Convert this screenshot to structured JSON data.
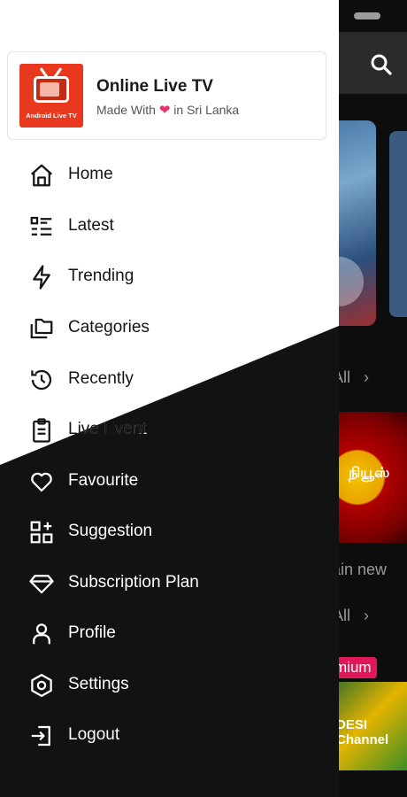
{
  "app": {
    "title": "Online Live TV",
    "subtitle_prefix": "Made With",
    "subtitle_suffix": "in Sri Lanka",
    "logo_text": "Android Live TV"
  },
  "menu": [
    {
      "label": "Home",
      "icon": "home-icon"
    },
    {
      "label": "Latest",
      "icon": "list-icon"
    },
    {
      "label": "Trending",
      "icon": "lightning-icon"
    },
    {
      "label": "Categories",
      "icon": "folders-icon"
    },
    {
      "label": "Recently",
      "icon": "history-icon"
    },
    {
      "label": "Live Event",
      "icon": "clipboard-icon"
    },
    {
      "label": "Favourite",
      "icon": "heart-icon"
    },
    {
      "label": "Suggestion",
      "icon": "grid-add-icon"
    },
    {
      "label": "Subscription Plan",
      "icon": "diamond-icon"
    },
    {
      "label": "Profile",
      "icon": "person-icon"
    },
    {
      "label": "Settings",
      "icon": "settings-icon"
    },
    {
      "label": "Logout",
      "icon": "logout-icon"
    }
  ],
  "background": {
    "see_all_1": "e All",
    "see_all_2": "e All",
    "card_title": "ptain new",
    "badge": "mium",
    "card1_text": "நியூஸ்",
    "card2_text": "DESI Channel"
  },
  "colors": {
    "drawer_light": "#ffffff",
    "drawer_dark": "#121212",
    "accent_logo": "#e8391f",
    "heart": "#e8316a",
    "premium_badge": "#e0185a"
  }
}
